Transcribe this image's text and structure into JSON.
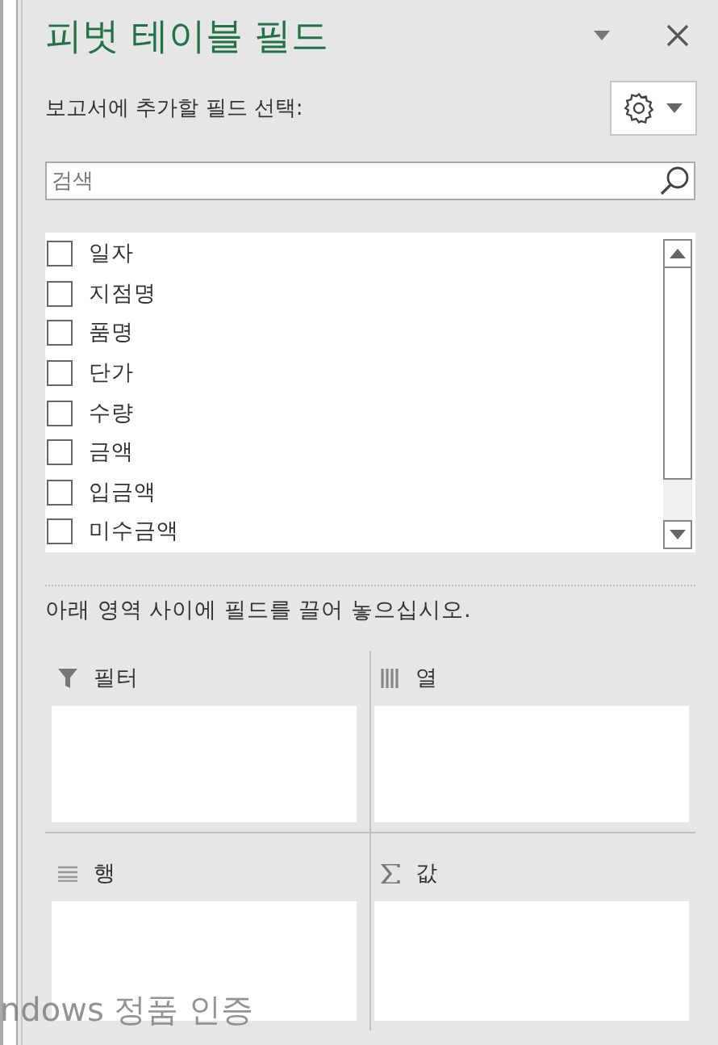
{
  "pane": {
    "title": "피벗 테이블 필드",
    "choose_label": "보고서에 추가할 필드 선택:"
  },
  "search": {
    "placeholder": "검색"
  },
  "fields": [
    {
      "label": "일자",
      "checked": false
    },
    {
      "label": "지점명",
      "checked": false
    },
    {
      "label": "품명",
      "checked": false
    },
    {
      "label": "단가",
      "checked": false
    },
    {
      "label": "수량",
      "checked": false
    },
    {
      "label": "금액",
      "checked": false
    },
    {
      "label": "입금액",
      "checked": false
    },
    {
      "label": "미수금액",
      "checked": false
    }
  ],
  "drag_hint": "아래 영역 사이에 필드를 끌어 놓으십시오.",
  "areas": [
    {
      "kind": "filter",
      "label": "필터"
    },
    {
      "kind": "columns",
      "label": "열"
    },
    {
      "kind": "rows",
      "label": "행"
    },
    {
      "kind": "values",
      "label": "값"
    }
  ],
  "overlay": {
    "text": "ndows 정품 인증"
  }
}
